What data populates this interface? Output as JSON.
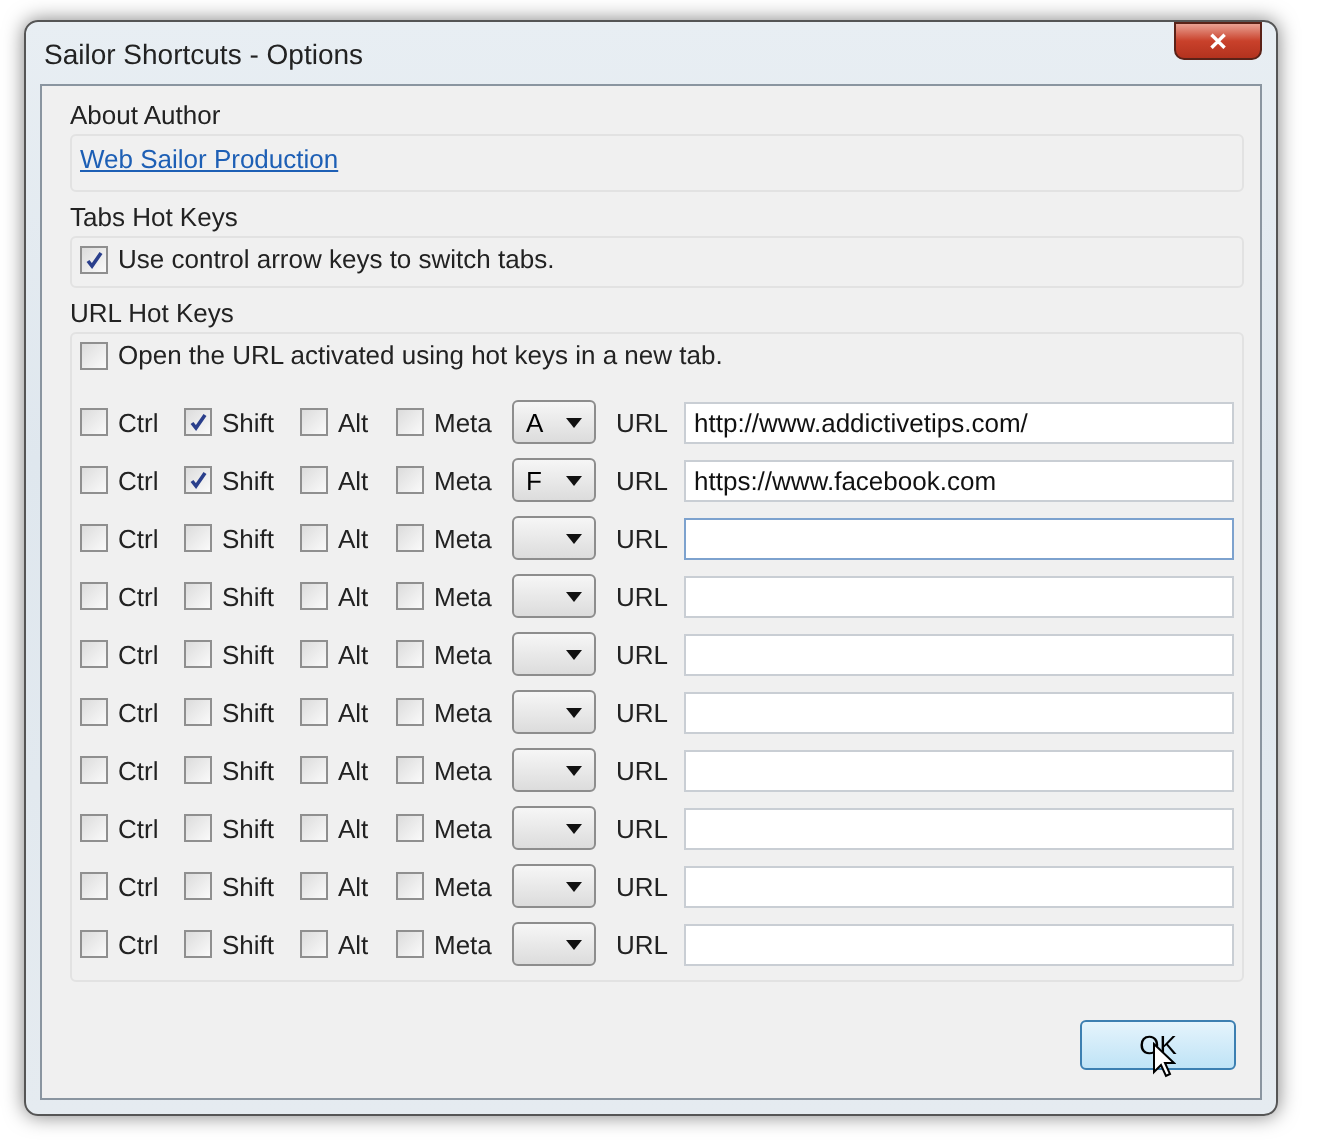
{
  "window": {
    "title": "Sailor Shortcuts - Options",
    "close": "✕"
  },
  "about": {
    "heading": "About Author",
    "link": "Web Sailor Production"
  },
  "tabs_hot_keys": {
    "heading": "Tabs Hot Keys",
    "option": {
      "label": "Use control arrow keys to switch tabs.",
      "checked": true
    }
  },
  "url_hot_keys": {
    "heading": "URL Hot Keys",
    "option": {
      "label": "Open the URL activated using hot keys in a new tab.",
      "checked": false
    },
    "rows": [
      {
        "modifiers": [
          {
            "label": "Ctrl",
            "checked": false
          },
          {
            "label": "Shift",
            "checked": true
          },
          {
            "label": "Alt",
            "checked": false
          },
          {
            "label": "Meta",
            "checked": false
          }
        ],
        "key": "A",
        "url_label": "URL",
        "url": "http://www.addictivetips.com/"
      },
      {
        "modifiers": [
          {
            "label": "Ctrl",
            "checked": false
          },
          {
            "label": "Shift",
            "checked": true
          },
          {
            "label": "Alt",
            "checked": false
          },
          {
            "label": "Meta",
            "checked": false
          }
        ],
        "key": "F",
        "url_label": "URL",
        "url": "https://www.facebook.com"
      },
      {
        "modifiers": [
          {
            "label": "Ctrl",
            "checked": false
          },
          {
            "label": "Shift",
            "checked": false
          },
          {
            "label": "Alt",
            "checked": false
          },
          {
            "label": "Meta",
            "checked": false
          }
        ],
        "url_label": "URL"
      },
      {
        "modifiers": [
          {
            "label": "Ctrl",
            "checked": false
          },
          {
            "label": "Shift",
            "checked": false
          },
          {
            "label": "Alt",
            "checked": false
          },
          {
            "label": "Meta",
            "checked": false
          }
        ],
        "url_label": "URL"
      },
      {
        "modifiers": [
          {
            "label": "Ctrl",
            "checked": false
          },
          {
            "label": "Shift",
            "checked": false
          },
          {
            "label": "Alt",
            "checked": false
          },
          {
            "label": "Meta",
            "checked": false
          }
        ],
        "url_label": "URL"
      },
      {
        "modifiers": [
          {
            "label": "Ctrl",
            "checked": false
          },
          {
            "label": "Shift",
            "checked": false
          },
          {
            "label": "Alt",
            "checked": false
          },
          {
            "label": "Meta",
            "checked": false
          }
        ],
        "url_label": "URL"
      },
      {
        "modifiers": [
          {
            "label": "Ctrl",
            "checked": false
          },
          {
            "label": "Shift",
            "checked": false
          },
          {
            "label": "Alt",
            "checked": false
          },
          {
            "label": "Meta",
            "checked": false
          }
        ],
        "url_label": "URL"
      },
      {
        "modifiers": [
          {
            "label": "Ctrl",
            "checked": false
          },
          {
            "label": "Shift",
            "checked": false
          },
          {
            "label": "Alt",
            "checked": false
          },
          {
            "label": "Meta",
            "checked": false
          }
        ],
        "url_label": "URL"
      },
      {
        "modifiers": [
          {
            "label": "Ctrl",
            "checked": false
          },
          {
            "label": "Shift",
            "checked": false
          },
          {
            "label": "Alt",
            "checked": false
          },
          {
            "label": "Meta",
            "checked": false
          }
        ],
        "url_label": "URL"
      },
      {
        "modifiers": [
          {
            "label": "Ctrl",
            "checked": false
          },
          {
            "label": "Shift",
            "checked": false
          },
          {
            "label": "Alt",
            "checked": false
          },
          {
            "label": "Meta",
            "checked": false
          }
        ],
        "url_label": "URL"
      }
    ]
  },
  "buttons": [
    {
      "label": "OK"
    }
  ]
}
